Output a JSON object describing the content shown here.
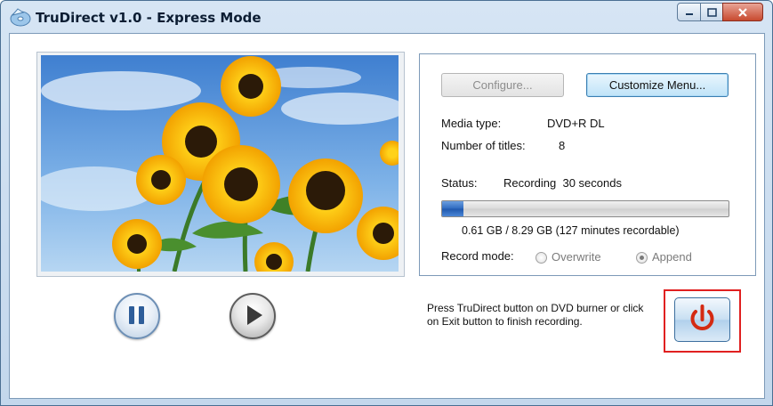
{
  "window": {
    "title": "TruDirect v1.0 - Express Mode",
    "icon": "dvd-app-icon",
    "caption_buttons": [
      "minimize-icon",
      "maximize-icon",
      "close-icon"
    ]
  },
  "preview": {
    "description_icon": "sunflower-video-preview"
  },
  "playback": {
    "pause_icon": "pause-icon",
    "play_icon": "play-icon"
  },
  "panel": {
    "configure_label": "Configure...",
    "customize_label": "Customize Menu...",
    "media_type_label": "Media type:",
    "media_type_value": "DVD+R DL",
    "titles_label": "Number of titles:",
    "titles_value": "8",
    "status_label": "Status:",
    "status_value": "Recording  30 seconds",
    "progress_fraction": 0.074,
    "capacity_text": "0.61 GB / 8.29 GB (127 minutes recordable)",
    "record_mode_label": "Record mode:",
    "record_modes": [
      {
        "label": "Overwrite",
        "selected": false
      },
      {
        "label": "Append",
        "selected": true
      }
    ]
  },
  "help_text": "Press TruDirect button on DVD burner or click on Exit button to finish recording.",
  "exit": {
    "icon": "power-icon"
  },
  "colors": {
    "exit_highlight": "#e02020",
    "progress_fill": "#2e69bf",
    "power_icon": "#d42a12"
  }
}
